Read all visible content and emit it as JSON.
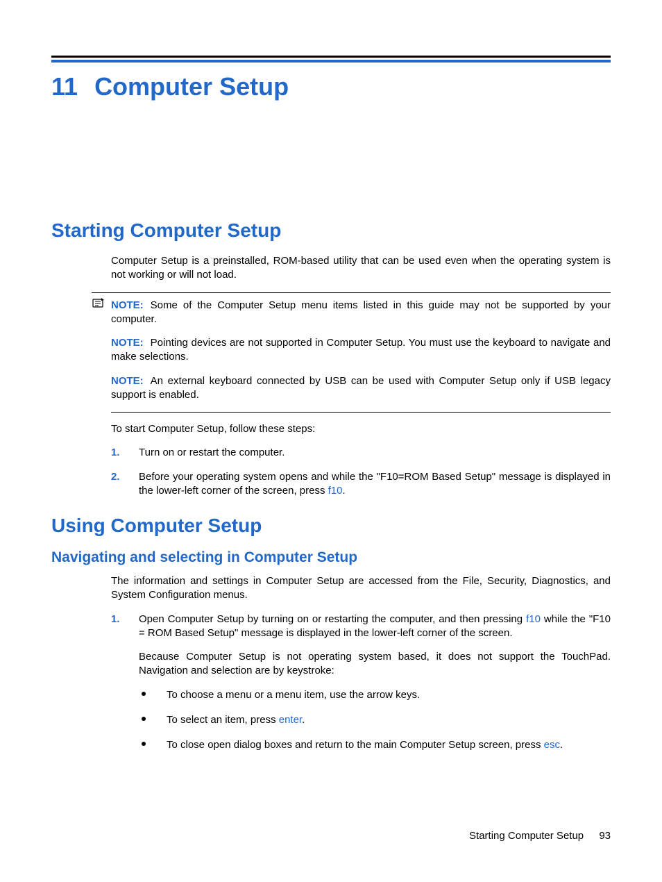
{
  "chapter": {
    "number": "11",
    "title": "Computer Setup"
  },
  "section1": {
    "heading": "Starting Computer Setup",
    "intro": "Computer Setup is a preinstalled, ROM-based utility that can be used even when the operating system is not working or will not load.",
    "notes": {
      "label": "NOTE:",
      "n1": "Some of the Computer Setup menu items listed in this guide may not be supported by your computer.",
      "n2": "Pointing devices are not supported in Computer Setup. You must use the keyboard to navigate and make selections.",
      "n3": "An external keyboard connected by USB can be used with Computer Setup only if USB legacy support is enabled."
    },
    "lead": "To start Computer Setup, follow these steps:",
    "steps": {
      "s1_marker": "1.",
      "s1": "Turn on or restart the computer.",
      "s2_marker": "2.",
      "s2_a": "Before your operating system opens and while the \"F10=ROM Based Setup\" message is displayed in the lower-left corner of the screen, press ",
      "s2_key": "f10",
      "s2_b": "."
    }
  },
  "section2": {
    "heading": "Using Computer Setup",
    "sub1": {
      "heading": "Navigating and selecting in Computer Setup",
      "intro": "The information and settings in Computer Setup are accessed from the File, Security, Diagnostics, and System Configuration menus.",
      "step1_marker": "1.",
      "step1_a": "Open Computer Setup by turning on or restarting the computer, and then pressing ",
      "step1_key": "f10",
      "step1_b": " while the \"F10 = ROM Based Setup\" message is displayed in the lower-left corner of the screen.",
      "step1_para2": "Because Computer Setup is not operating system based, it does not support the TouchPad. Navigation and selection are by keystroke:",
      "bullets": {
        "b1": "To choose a menu or a menu item, use the arrow keys.",
        "b2_a": "To select an item, press ",
        "b2_key": "enter",
        "b2_b": ".",
        "b3_a": "To close open dialog boxes and return to the main Computer Setup screen, press ",
        "b3_key": "esc",
        "b3_b": "."
      }
    }
  },
  "footer": {
    "text": "Starting Computer Setup",
    "page": "93"
  }
}
